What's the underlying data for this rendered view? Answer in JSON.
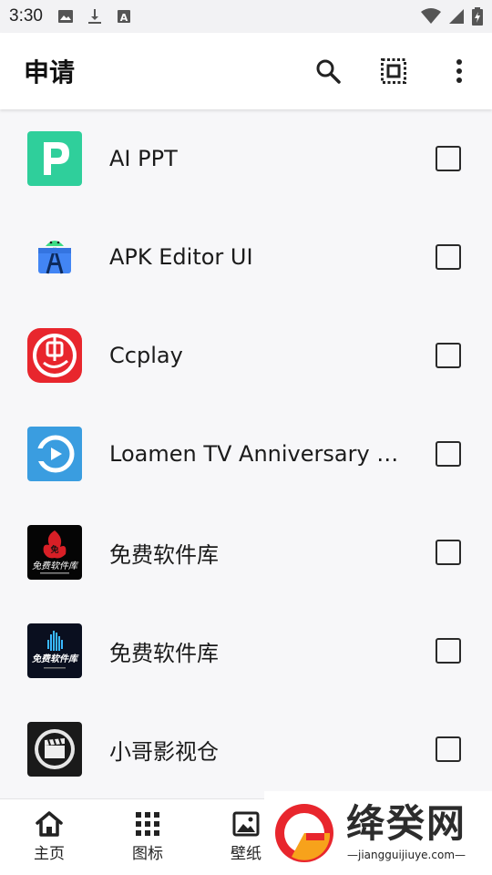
{
  "status_bar": {
    "time": "3:30",
    "left_icons": [
      "image-icon",
      "download-icon",
      "font-icon"
    ],
    "right_icons": [
      "wifi-icon",
      "signal-icon",
      "battery-icon"
    ]
  },
  "app_bar": {
    "title": "申请",
    "actions": [
      "search-icon",
      "select-all-icon",
      "more-vert-icon"
    ]
  },
  "apps": [
    {
      "name": "AI PPT",
      "icon": "ai-ppt-logo",
      "checked": false
    },
    {
      "name": "APK Editor UI",
      "icon": "android-editor-logo",
      "checked": false
    },
    {
      "name": "Ccplay",
      "icon": "ccplay-logo",
      "checked": false
    },
    {
      "name": "Loamen TV Anniversary Ed...",
      "icon": "loamen-tv-logo",
      "checked": false
    },
    {
      "name": "免费软件库",
      "icon": "software-lib-logo-red",
      "checked": false
    },
    {
      "name": "免费软件库",
      "icon": "software-lib-logo-blue",
      "checked": false
    },
    {
      "name": "小哥影视仓",
      "icon": "clapper-logo",
      "checked": false
    }
  ],
  "bottom_nav": [
    {
      "label": "主页",
      "icon": "home-icon"
    },
    {
      "label": "图标",
      "icon": "grid-icon"
    },
    {
      "label": "壁纸",
      "icon": "image-icon"
    }
  ],
  "watermark": {
    "name": "绛癸网",
    "url": "jiangguijiuye.com"
  },
  "colors": {
    "ai_ppt_bg": "#2fcf9b",
    "ccplay_red": "#e8262d",
    "loamen_blue": "#3a9de0"
  }
}
